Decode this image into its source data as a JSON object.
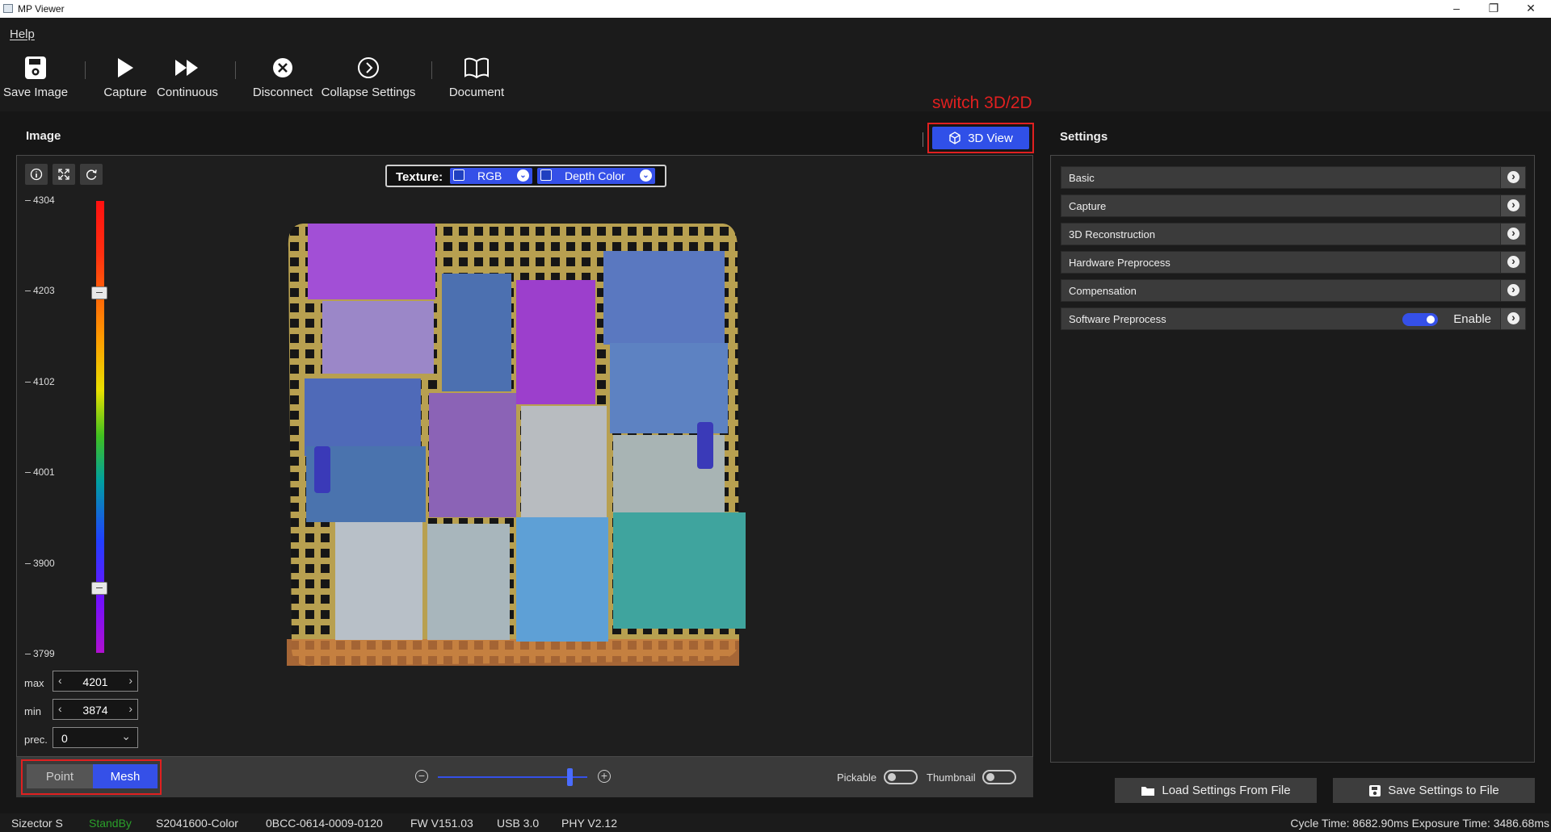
{
  "window": {
    "title": "MP Viewer"
  },
  "menu": {
    "help": "Help"
  },
  "toolbar": {
    "save_image": "Save Image",
    "capture": "Capture",
    "continuous": "Continuous",
    "disconnect": "Disconnect",
    "collapse_settings": "Collapse Settings",
    "document": "Document"
  },
  "annotation": "switch 3D/2D",
  "image_panel": {
    "title": "Image",
    "view_button": "3D View",
    "texture": {
      "label": "Texture:",
      "option1": "RGB",
      "option2": "Depth Color"
    },
    "colorbar_ticks": [
      "4304",
      "4203",
      "4102",
      "4001",
      "3900",
      "3799"
    ],
    "max_label": "max",
    "max_value": "4201",
    "min_label": "min",
    "min_value": "3874",
    "prec_label": "prec.",
    "prec_value": "0",
    "mode": {
      "point": "Point",
      "mesh": "Mesh",
      "selected": "Mesh"
    },
    "pickable_label": "Pickable",
    "thumbnail_label": "Thumbnail"
  },
  "settings": {
    "title": "Settings",
    "items": [
      {
        "label": "Basic"
      },
      {
        "label": "Capture"
      },
      {
        "label": "3D Reconstruction"
      },
      {
        "label": "Hardware Preprocess"
      },
      {
        "label": "Compensation"
      },
      {
        "label": "Software Preprocess"
      }
    ],
    "enable_label": "Enable",
    "load_button": "Load Settings From File",
    "save_button": "Save Settings to File"
  },
  "status": {
    "model": "Sizector S",
    "state": "StandBy",
    "serial": "S2041600-Color",
    "id": "0BCC-0614-0009-0120",
    "fw": "FW V151.03",
    "usb": "USB 3.0",
    "phy": "PHY V2.12",
    "timing": "Cycle Time: 8682.90ms Exposure Time: 3486.68ms"
  },
  "colors": {
    "accent": "#3550e8",
    "annotation": "#e02020",
    "standby": "#2aa02a"
  }
}
